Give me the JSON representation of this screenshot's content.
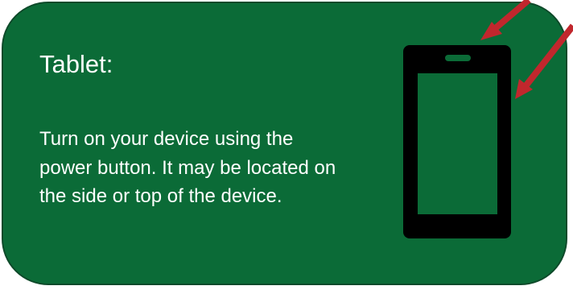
{
  "card": {
    "title": "Tablet:",
    "instructions": "Turn on your device using the power button. It may be located on the side or top of the device."
  },
  "illustration": {
    "device_icon": "smartphone-icon",
    "pointer_icon": "arrow-icon",
    "colors": {
      "card_background": "#0b6b37",
      "device_body": "#000000",
      "device_screen": "#0b6b37",
      "arrows": "#c1272d"
    }
  }
}
